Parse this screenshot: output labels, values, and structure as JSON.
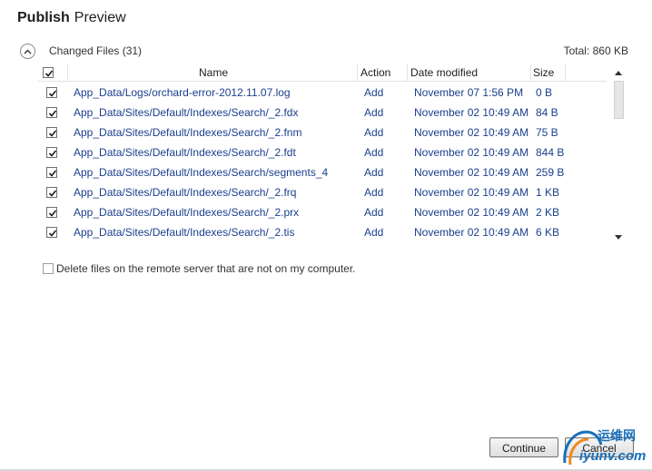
{
  "header": {
    "title_bold": "Publish",
    "title_light": "Preview"
  },
  "section": {
    "label": "Changed Files (31)",
    "total": "Total: 860 KB"
  },
  "grid": {
    "columns": {
      "name": "Name",
      "action": "Action",
      "date": "Date modified",
      "size": "Size"
    },
    "rows": [
      {
        "name": "App_Data/Logs/orchard-error-2012.11.07.log",
        "action": "Add",
        "date": "November 07 1:56 PM",
        "size": "0 B"
      },
      {
        "name": "App_Data/Sites/Default/Indexes/Search/_2.fdx",
        "action": "Add",
        "date": "November 02 10:49 AM",
        "size": "84 B"
      },
      {
        "name": "App_Data/Sites/Default/Indexes/Search/_2.fnm",
        "action": "Add",
        "date": "November 02 10:49 AM",
        "size": "75 B"
      },
      {
        "name": "App_Data/Sites/Default/Indexes/Search/_2.fdt",
        "action": "Add",
        "date": "November 02 10:49 AM",
        "size": "844 B"
      },
      {
        "name": "App_Data/Sites/Default/Indexes/Search/segments_4",
        "action": "Add",
        "date": "November 02 10:49 AM",
        "size": "259 B"
      },
      {
        "name": "App_Data/Sites/Default/Indexes/Search/_2.frq",
        "action": "Add",
        "date": "November 02 10:49 AM",
        "size": "1 KB"
      },
      {
        "name": "App_Data/Sites/Default/Indexes/Search/_2.prx",
        "action": "Add",
        "date": "November 02 10:49 AM",
        "size": "2 KB"
      },
      {
        "name": "App_Data/Sites/Default/Indexes/Search/_2.tis",
        "action": "Add",
        "date": "November 02 10:49 AM",
        "size": "6 KB"
      }
    ]
  },
  "options": {
    "delete_remote": "Delete files on the remote server that are not on my computer."
  },
  "buttons": {
    "continue": "Continue",
    "cancel": "Cancel"
  },
  "watermark": {
    "line1": "运维网",
    "line2": "iyunv.com"
  },
  "colors": {
    "link_text": "#1a3f8c",
    "watermark": "#1a6fb8"
  }
}
